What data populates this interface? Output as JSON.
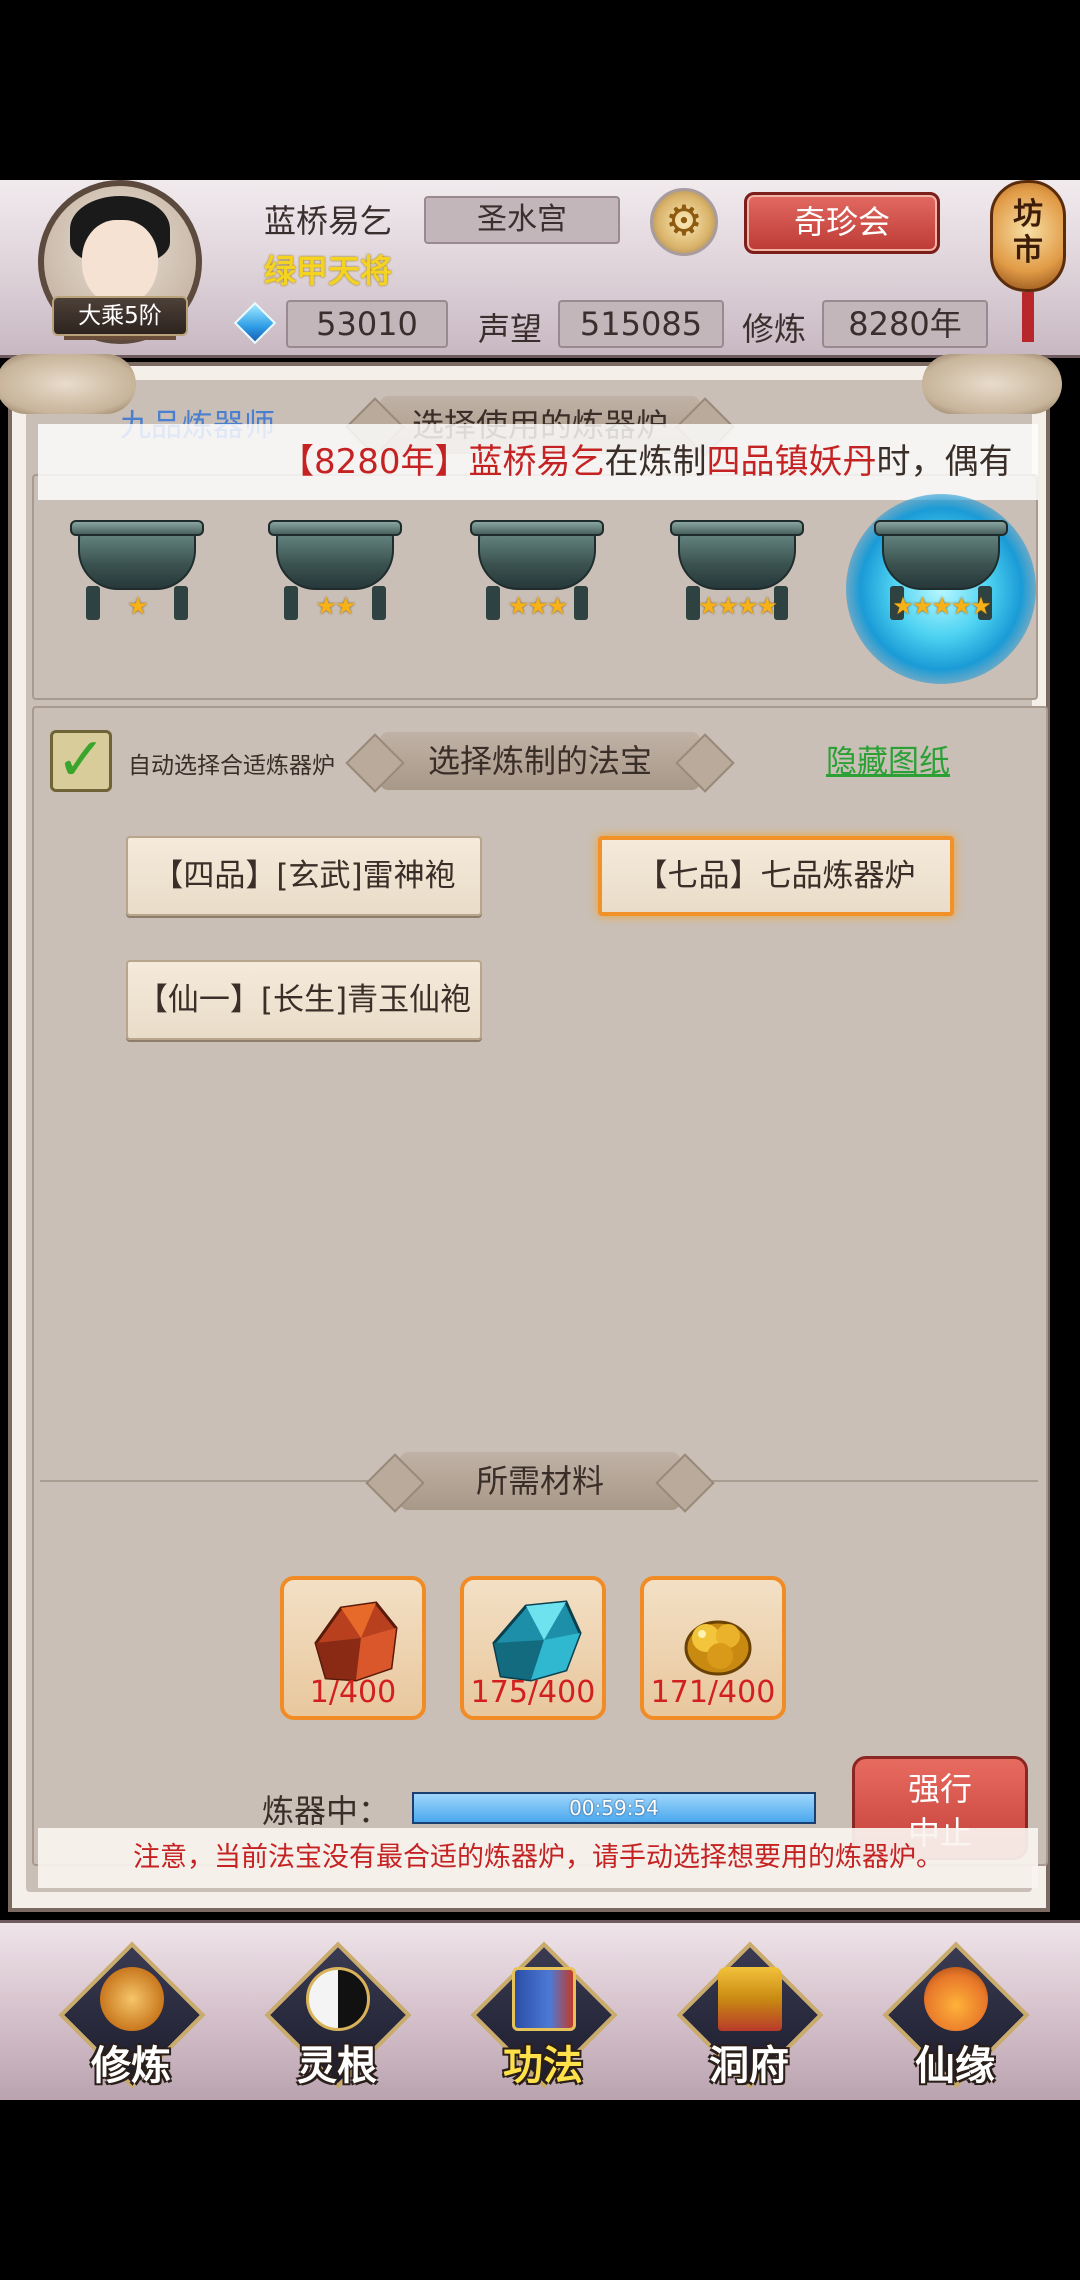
{
  "player": {
    "name": "蓝桥易乞",
    "title": "绿甲天将",
    "rank": "大乘5阶",
    "sect": "圣水宫",
    "gems": "53010",
    "reputation_label": "声望",
    "reputation": "515085",
    "cultivation_label": "修炼",
    "cultivation": "8280年"
  },
  "header": {
    "treasure_button": "奇珍会",
    "market_label": "坊市",
    "settings_icon": "gear-icon",
    "gem_icon": "blue-gem-icon"
  },
  "furnace_section": {
    "alchemist_title": "九品炼器师",
    "banner": "选择使用的炼器炉",
    "furnaces": [
      {
        "stars": "★"
      },
      {
        "stars": "★★"
      },
      {
        "stars": "★★★"
      },
      {
        "stars": "★★★★"
      },
      {
        "stars": "★★★★★"
      }
    ]
  },
  "marquee": {
    "part1": "【",
    "year": "8280年",
    "part2": "】",
    "player": "蓝桥易乞",
    "part3": "在炼制",
    "item": "四品镇妖丹",
    "part4": "时，偶有"
  },
  "treasure_section": {
    "auto_select_label": "自动选择合适炼器炉",
    "banner": "选择炼制的法宝",
    "hide_link": "隐藏图纸",
    "items": [
      {
        "label": "【四品】[玄武]雷神袍"
      },
      {
        "label": "【七品】七品炼器炉"
      },
      {
        "label": "【仙一】[长生]青玉仙袍"
      }
    ]
  },
  "materials": {
    "banner": "所需材料",
    "items": [
      {
        "count": "1/400",
        "icon": "red-ore-icon"
      },
      {
        "count": "175/400",
        "icon": "blue-crystal-icon"
      },
      {
        "count": "171/400",
        "icon": "gold-nugget-icon"
      }
    ]
  },
  "crafting": {
    "label": "炼器中：",
    "timer": "00:59:54",
    "progress_fraction": 1.0,
    "force_stop_line1": "强行",
    "force_stop_line2": "中止"
  },
  "notice": "注意，当前法宝没有最合适的炼器炉，请手动选择想要用的炼器炉。",
  "nav": [
    {
      "label": "修炼",
      "icon": "cultivate-icon"
    },
    {
      "label": "灵根",
      "icon": "spirit-root-icon"
    },
    {
      "label": "功法",
      "icon": "technique-book-icon"
    },
    {
      "label": "洞府",
      "icon": "cave-dwelling-icon"
    },
    {
      "label": "仙缘",
      "icon": "gourd-icon"
    }
  ],
  "colors": {
    "accent_red": "#c52323",
    "title_yellow": "#f5d323",
    "link_green": "#2aa035",
    "alchemist_blue": "#4a7fd0",
    "selected_orange": "#f09227"
  }
}
